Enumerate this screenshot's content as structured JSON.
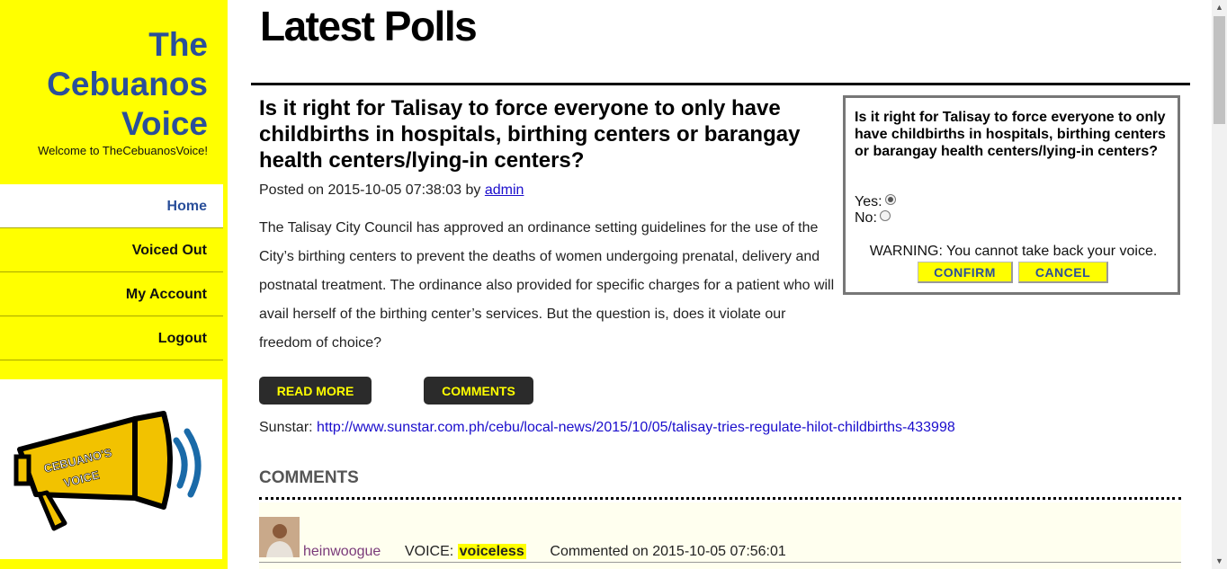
{
  "sidebar": {
    "brand_line1": "The",
    "brand_line2": "Cebuanos",
    "brand_line3": "Voice",
    "tagline": "Welcome to TheCebuanosVoice!",
    "nav": [
      {
        "label": "Home",
        "active": true
      },
      {
        "label": "Voiced Out"
      },
      {
        "label": "My Account"
      },
      {
        "label": "Logout"
      }
    ],
    "logo_text_line1": "CEBUANO'S",
    "logo_text_line2": "VOICE"
  },
  "main": {
    "page_title": "Latest Polls",
    "post": {
      "title": "Is it right for Talisay to force everyone to only have childbirths in hospitals, birthing centers or barangay health centers/lying-in centers?",
      "posted_prefix": "Posted on 2015-10-05 07:38:03 by",
      "author": "admin",
      "body": "The Talisay City Council has approved an ordinance setting guidelines for the use of the City’s birthing centers to prevent the deaths of women undergoing prenatal, delivery and postnatal treatment. The ordinance also provided for specific charges for a patient who will avail herself of the birthing center’s services. But the question is, does it violate our freedom of choice?",
      "read_more_label": "READ MORE",
      "comments_label": "COMMENTS",
      "source_label": "Sunstar:",
      "source_url": "http://www.sunstar.com.ph/cebu/local-news/2015/10/05/talisay-tries-regulate-hilot-childbirths-433998"
    },
    "comments": {
      "heading": "COMMENTS",
      "items": [
        {
          "user": "heinwoogue",
          "voice_label": "VOICE:",
          "voice_value": "voiceless",
          "commented": "Commented on 2015-10-05 07:56:01"
        }
      ]
    }
  },
  "poll": {
    "question": "Is it right for Talisay to force everyone to only have childbirths in hospitals, birthing centers or barangay health centers/lying-in centers?",
    "option_yes": "Yes:",
    "option_no": "No:",
    "selected": "yes",
    "warning": "WARNING: You cannot take back your voice.",
    "confirm_label": "CONFIRM",
    "cancel_label": "CANCEL"
  },
  "colors": {
    "sidebar_bg": "#ffff00",
    "brand_blue": "#2a4f9a",
    "dark_button": "#2b2b2b",
    "link": "#1a0dcc"
  }
}
